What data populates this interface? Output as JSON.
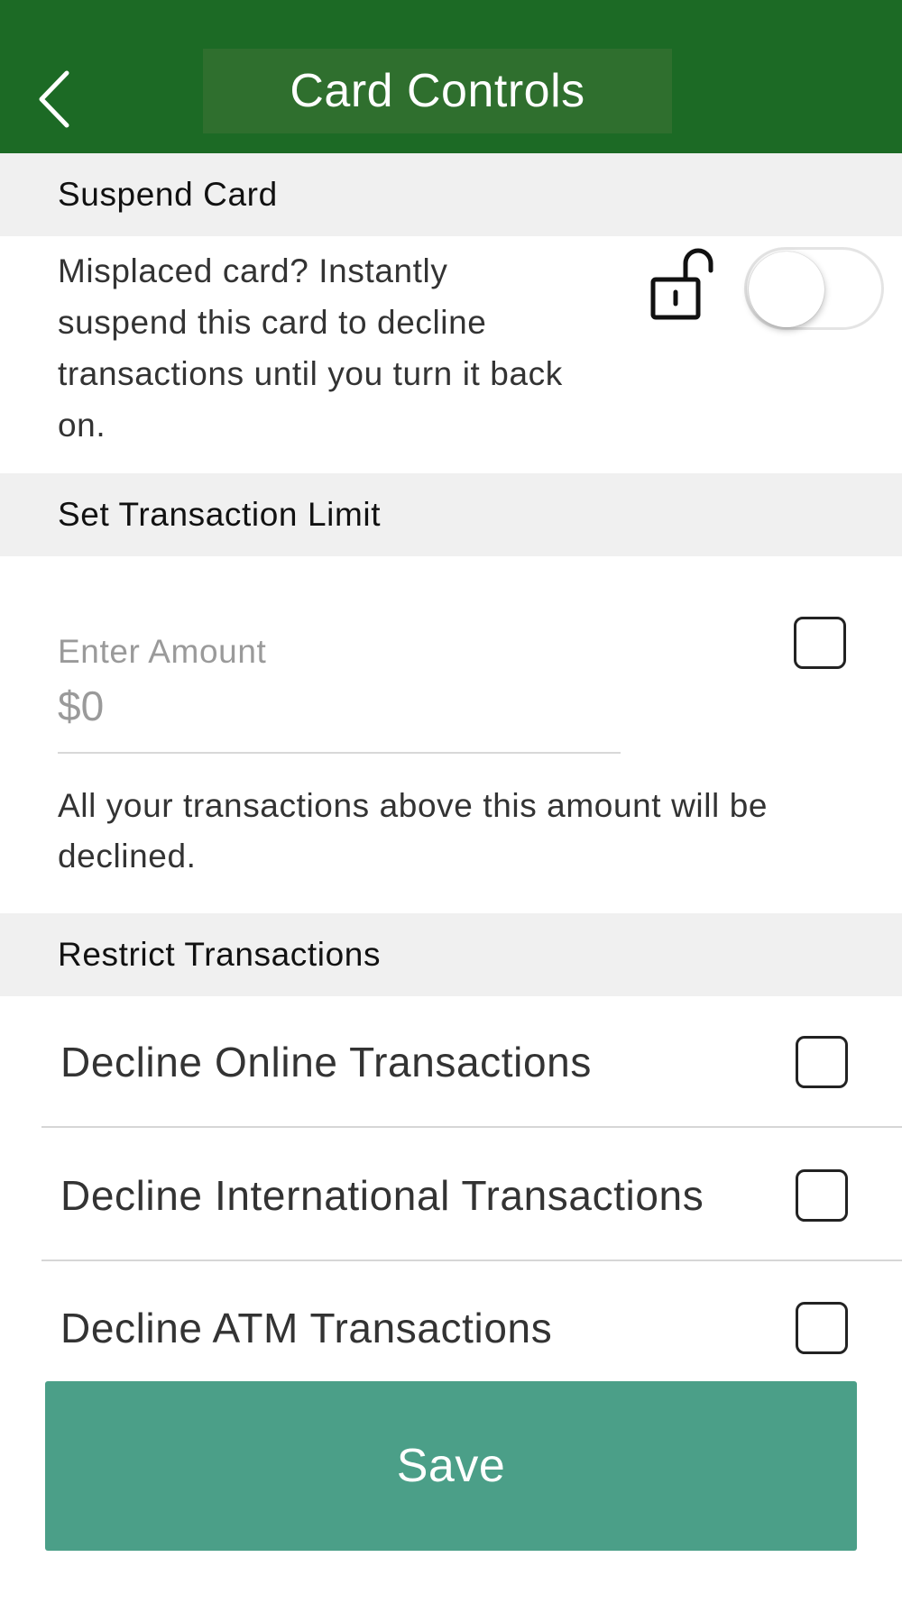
{
  "header": {
    "title": "Card Controls",
    "back_icon": "chevron-left-icon",
    "background_color": "#1c6a25"
  },
  "suspend": {
    "section_title": "Suspend Card",
    "description": "Misplaced card? Instantly suspend this card to decline transactions until you turn it back on.",
    "lock_icon": "unlocked-padlock-icon",
    "toggle_on": false
  },
  "limit": {
    "section_title": "Set Transaction Limit",
    "field_label": "Enter Amount",
    "placeholder": "$0",
    "value": "",
    "checked": false,
    "description": "All your transactions above this amount will be declined."
  },
  "restrict": {
    "section_title": "Restrict Transactions",
    "items": [
      {
        "label": "Decline Online Transactions",
        "checked": false
      },
      {
        "label": "Decline International Transactions",
        "checked": false
      },
      {
        "label": "Decline ATM Transactions",
        "checked": false
      }
    ]
  },
  "save": {
    "label": "Save",
    "color": "#4b9f88"
  }
}
